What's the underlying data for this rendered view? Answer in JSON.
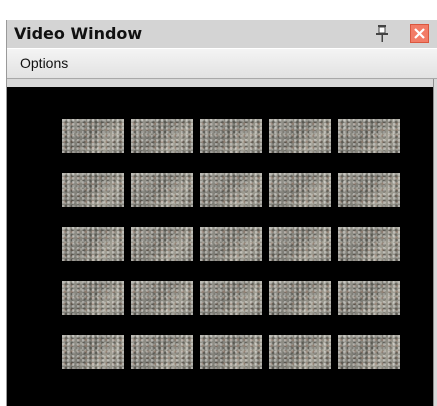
{
  "window": {
    "title": "Video Window"
  },
  "menu": {
    "options_label": "Options"
  },
  "icons": {
    "pin": "pin-icon",
    "close": "close-icon"
  },
  "colors": {
    "close_button": "#f27c67",
    "video_background": "#000000"
  },
  "video": {
    "rows": 5,
    "columns": 5
  }
}
